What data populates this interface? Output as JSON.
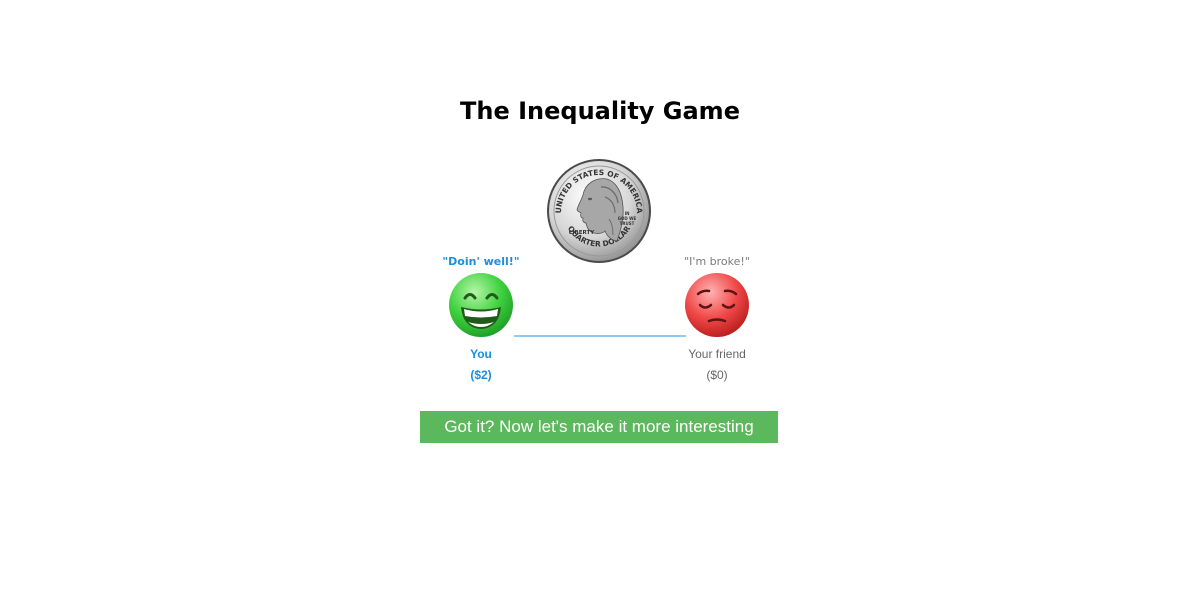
{
  "game": {
    "title": "The Inequality Game"
  },
  "coin": {
    "icon": "quarter-coin-icon",
    "top_text": "UNITED STATES OF AMERICA",
    "left_text": "LIBERTY",
    "motto": "IN GOD WE TRUST",
    "bottom_text": "QUARTER DOLLAR"
  },
  "players": {
    "you": {
      "quote": "\"Doin' well!\"",
      "name": "You",
      "money": "($2)",
      "mood_icon": "grinning-face-icon",
      "color": "#1a8fe0",
      "face_color": "#3fd23f"
    },
    "friend": {
      "quote": "\"I'm broke!\"",
      "name": "Your friend",
      "money": "($0)",
      "mood_icon": "pensive-face-icon",
      "color": "#666666",
      "face_color": "#f04848"
    }
  },
  "actions": {
    "next_label": "Got it? Now let's make it more interesting",
    "button_color": "#5cb85c"
  }
}
